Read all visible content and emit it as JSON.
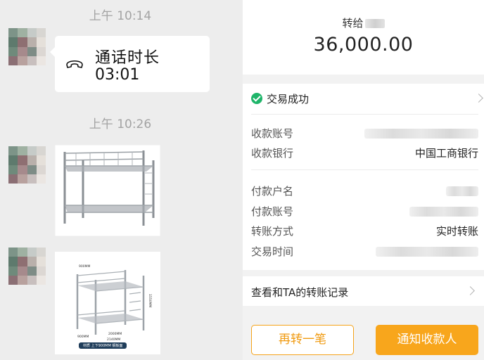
{
  "chat": {
    "timestamps": [
      "上午 10:14",
      "上午 10:26"
    ],
    "call": {
      "icon": "phone-handset-icon",
      "title": "通话时长",
      "duration": "03:01"
    },
    "images": [
      {
        "name": "bunk-bed-photo-1"
      },
      {
        "name": "bunk-bed-photo-2",
        "dims": [
          "900MM",
          "1550MM",
          "2000MM",
          "2140MM",
          "900MM"
        ],
        "caption": "材质  上下900MM  钢板面"
      }
    ]
  },
  "transfer": {
    "to_label": "转给",
    "amount": "36,000.00",
    "status": {
      "icon": "check-circle-icon",
      "text": "交易成功",
      "color": "#1fb56a"
    },
    "rows": [
      {
        "label": "收款账号",
        "value": ""
      },
      {
        "label": "收款银行",
        "value": "中国工商银行"
      },
      {
        "label": "付款户名",
        "value": ""
      },
      {
        "label": "付款账号",
        "value": ""
      },
      {
        "label": "转账方式",
        "value": "实时转账"
      },
      {
        "label": "交易时间",
        "value": ""
      }
    ],
    "history_link": "查看和TA的转账记录",
    "buttons": {
      "again": "再转一笔",
      "notify": "通知收款人"
    },
    "accent": "#f8a61c"
  }
}
